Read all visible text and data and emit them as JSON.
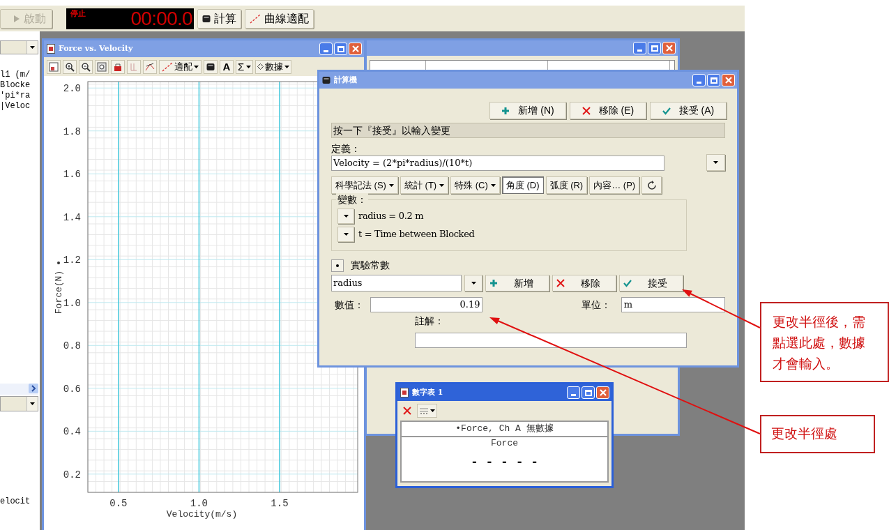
{
  "toolbar": {
    "start_button": {
      "label": "啟動",
      "disabled": true
    },
    "timer": {
      "status": "停止",
      "time": "00:00.0"
    },
    "buttons": [
      {
        "label": "計算",
        "kind": "calculate"
      },
      {
        "label": "曲線適配",
        "kind": "curve_fit"
      }
    ]
  },
  "left_panel": {
    "lines": [
      "l1 (m/",
      "Blocke",
      "'pi*ra",
      "|Veloc"
    ],
    "footer": "elocit"
  },
  "graph_window": {
    "title": "Force vs. Velocity",
    "toolbar": {
      "fit": "適配",
      "text_tool": "A",
      "stats": "Σ",
      "data": "數據"
    },
    "chart_data": {
      "type": "scatter",
      "grid": true,
      "xlabel": "Velocity(m/s)",
      "ylabel": "Force(N)",
      "xlim": [
        0.31,
        1.985
      ],
      "ylim": [
        0.115,
        2.03
      ],
      "xticks": [
        {
          "value": 0.5,
          "label": "0.5"
        },
        {
          "value": 1,
          "label": "1.0"
        },
        {
          "value": 1.5,
          "label": "1.5"
        }
      ],
      "yticks": [
        {
          "value": 0.2,
          "label": "0.2"
        },
        {
          "value": 0.4,
          "label": "0.4"
        },
        {
          "value": 0.6,
          "label": "0.6"
        },
        {
          "value": 0.8,
          "label": "0.8"
        },
        {
          "value": 1,
          "label": "1.0"
        },
        {
          "value": 1.2,
          "label": "1.2"
        },
        {
          "value": 1.4,
          "label": "1.4"
        },
        {
          "value": 1.6,
          "label": "1.6"
        },
        {
          "value": 1.8,
          "label": "1.8"
        },
        {
          "value": 2,
          "label": "2.0"
        }
      ]
    }
  },
  "calculator": {
    "title": "計算機",
    "buttons": [
      {
        "label": "新增 (N)",
        "kind": "add"
      },
      {
        "label": "移除 (E)",
        "kind": "remove"
      },
      {
        "label": "接受 (A)",
        "kind": "accept"
      }
    ],
    "message": "按一下『接受』以輸入變更",
    "definition_label": "定義：",
    "definition": "Velocity = (2*pi*radius)/(10*t)",
    "menus": [
      {
        "label": "科學記法 (S)",
        "kind": "menu",
        "selected": false
      },
      {
        "label": "統計 (T)",
        "kind": "menu",
        "selected": false
      },
      {
        "label": "特殊 (C)",
        "kind": "menu",
        "selected": false
      },
      {
        "label": "角度 (D)",
        "kind": "toggle",
        "selected": true
      },
      {
        "label": "弧度 (R)",
        "kind": "toggle",
        "selected": false
      },
      {
        "label": "內容… (P)",
        "kind": "button",
        "selected": false
      }
    ],
    "variables_label": "變數：",
    "variables": [
      "radius = 0.2 m",
      "t = Time between Blocked"
    ],
    "constants_label": "實驗常數",
    "constant_name": "radius",
    "constant_buttons": [
      {
        "label": "新增",
        "kind": "add"
      },
      {
        "label": "移除",
        "kind": "remove"
      },
      {
        "label": "接受",
        "kind": "accept"
      }
    ],
    "value_label": "數值：",
    "value": "0.19",
    "unit_label": "單位：",
    "unit": "m",
    "note_label": "註解："
  },
  "table_window": {
    "title": "數字表 1",
    "header": "•Force, Ch A 無數據",
    "column": "Force",
    "value": "- - - - -"
  },
  "annotations": [
    {
      "text": "更改半徑後，需點選此處，數據才會輸入。"
    },
    {
      "text": "更改半徑處"
    }
  ]
}
